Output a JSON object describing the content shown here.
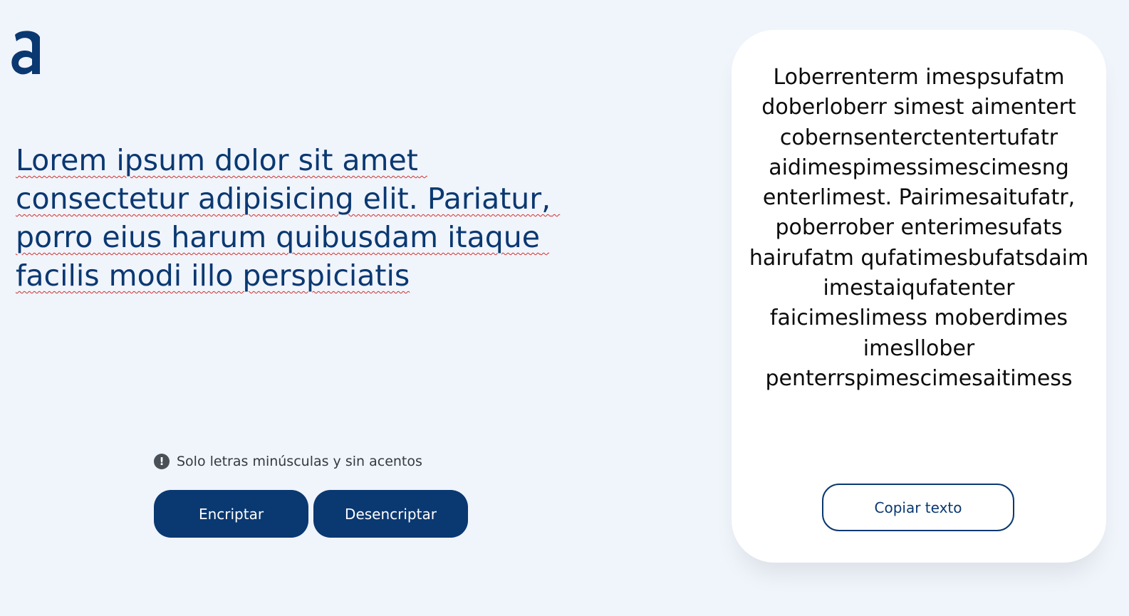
{
  "logo": {
    "icon": "alura-a-logo-icon",
    "color": "#0a3871"
  },
  "input": {
    "value": "Lorem ipsum dolor sit amet consectetur adipisicing elit. Pariatur, porro eius harum quibusdam itaque facilis modi illo perspiciatis"
  },
  "hint": {
    "icon": "exclamation-circle-icon",
    "text": "Solo letras minúsculas y sin acentos"
  },
  "actions": {
    "encrypt_label": "Encriptar",
    "decrypt_label": "Desencriptar"
  },
  "output": {
    "text": "Loberrenterm imespsufatm doberloberr simest aimentert cobernsenterctentertufatr aidimespimessimescimesng enterlimest. Pairimesaitufatr, poberrober enterimesufats hairufatm qufatimesbufatsdaim imestaiqufatenter faicimeslimess moberdimes imesllober penterrspimescimesaitimess",
    "copy_label": "Copiar texto"
  },
  "colors": {
    "background": "#f0f4fb",
    "primary": "#0a3871",
    "card": "#ffffff",
    "hint_text": "#343a40",
    "spellcheck_underline": "#d0312d"
  }
}
